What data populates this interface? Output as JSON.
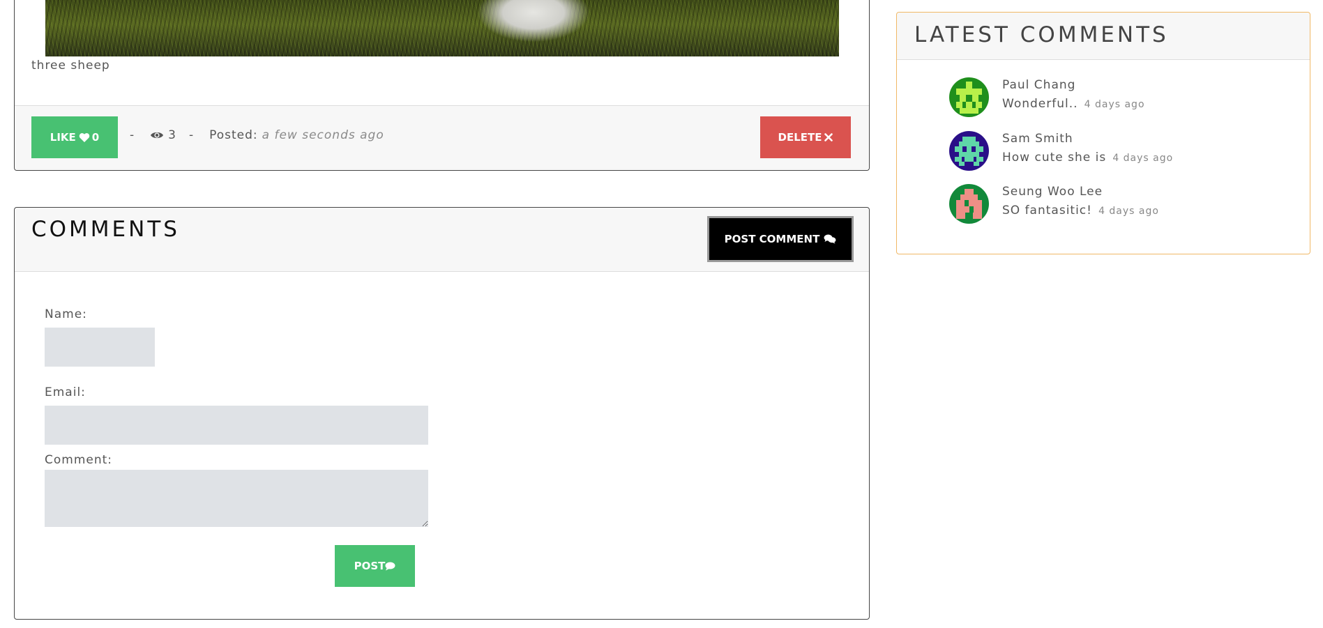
{
  "post": {
    "caption": "three sheep",
    "like_label": "LIKE",
    "like_count": "0",
    "separator": "-",
    "views": "3",
    "posted_label": "Posted:",
    "posted_time": "a few seconds ago",
    "delete_label": "DELETE",
    "icons": {
      "like": "heart-icon",
      "views": "eye-icon",
      "delete": "close-icon"
    }
  },
  "comments": {
    "title": "COMMENTS",
    "post_comment_label": "POST COMMENT",
    "form": {
      "name_label": "Name:",
      "name_value": "",
      "email_label": "Email:",
      "email_value": "",
      "comment_label": "Comment:",
      "comment_value": "",
      "post_label": "POST"
    },
    "icons": {
      "post_comment": "comments-icon",
      "post": "comment-icon"
    }
  },
  "latest_comments": {
    "title": "LATEST COMMENTS",
    "items": [
      {
        "author": "Paul Chang",
        "text": "Wonderful..",
        "time": "4 days ago",
        "avatar_bg": "#1f8f1c",
        "avatar_fg": "#b8f04a"
      },
      {
        "author": "Sam Smith",
        "text": "How cute she is",
        "time": "4 days ago",
        "avatar_bg": "#2a0f88",
        "avatar_fg": "#5fd6a8"
      },
      {
        "author": "Seung Woo Lee",
        "text": "SO fantasitic!",
        "time": "4 days ago",
        "avatar_bg": "#12893a",
        "avatar_fg": "#ee8f86"
      }
    ]
  },
  "colors": {
    "like_green": "#48c172",
    "delete_red": "#da534f",
    "post_comment_black": "#000000",
    "latest_border": "#f0b866",
    "input_bg": "#dfe2e6"
  }
}
